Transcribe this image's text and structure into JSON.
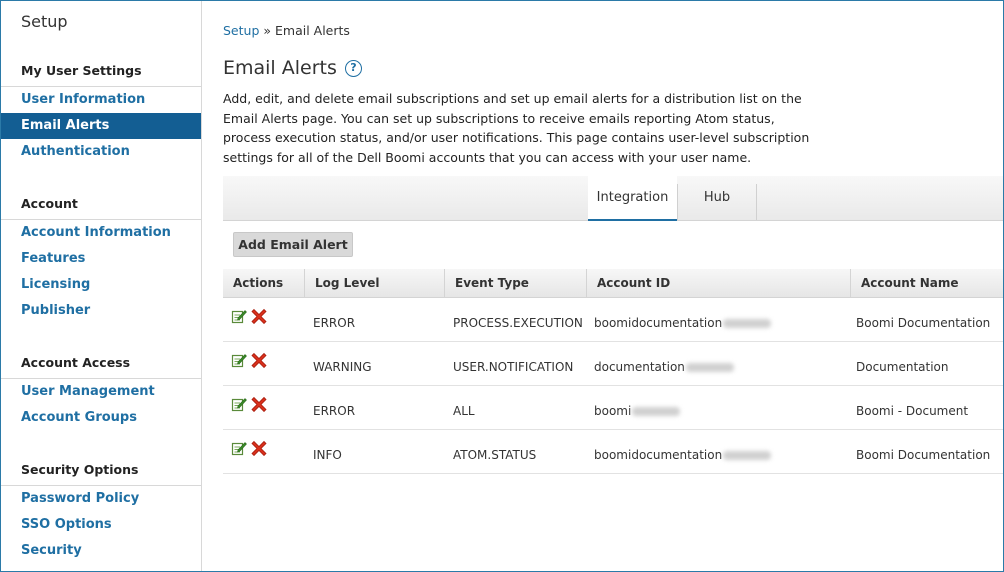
{
  "sidebar": {
    "title": "Setup",
    "sections": [
      {
        "heading": "My User Settings",
        "items": [
          "User Information",
          "Email Alerts",
          "Authentication"
        ]
      },
      {
        "heading": "Account",
        "items": [
          "Account Information",
          "Features",
          "Licensing",
          "Publisher"
        ]
      },
      {
        "heading": "Account Access",
        "items": [
          "User Management",
          "Account Groups"
        ]
      },
      {
        "heading": "Security Options",
        "items": [
          "Password Policy",
          "SSO Options",
          "Security"
        ]
      }
    ],
    "active_item": "Email Alerts"
  },
  "breadcrumb": {
    "root": "Setup",
    "separator": " » ",
    "current": "Email Alerts"
  },
  "page": {
    "title": "Email Alerts",
    "help_icon": "?",
    "description": "Add, edit, and delete email subscriptions and set up email alerts for a distribution list on the Email Alerts page. You can set up subscriptions to receive emails reporting Atom status, process execution status, and/or user notifications. This page contains user-level subscription settings for all of the Dell Boomi accounts that you can access with your user name."
  },
  "tabs": {
    "integration": "Integration",
    "hub": "Hub",
    "active": "Integration"
  },
  "add_button": "Add Email Alert",
  "table": {
    "columns": [
      "Actions",
      "Log Level",
      "Event Type",
      "Account ID",
      "Account Name"
    ],
    "rows": [
      {
        "log_level": "ERROR",
        "event_type": "PROCESS.EXECUTION",
        "account_id": "boomidocumentation",
        "account_name": "Boomi Documentation"
      },
      {
        "log_level": "WARNING",
        "event_type": "USER.NOTIFICATION",
        "account_id": "documentation",
        "account_name": "Documentation"
      },
      {
        "log_level": "ERROR",
        "event_type": "ALL",
        "account_id": "boomi",
        "account_name": "Boomi - Document"
      },
      {
        "log_level": "INFO",
        "event_type": "ATOM.STATUS",
        "account_id": "boomidocumentation",
        "account_name": "Boomi Documentation"
      }
    ]
  },
  "icons": {
    "edit": "edit-icon",
    "delete": "delete-icon"
  },
  "colors": {
    "accent": "#1f6fa3",
    "active_nav": "#135e93",
    "delete_red": "#d9301c",
    "edit_green": "#3a8a2a"
  }
}
